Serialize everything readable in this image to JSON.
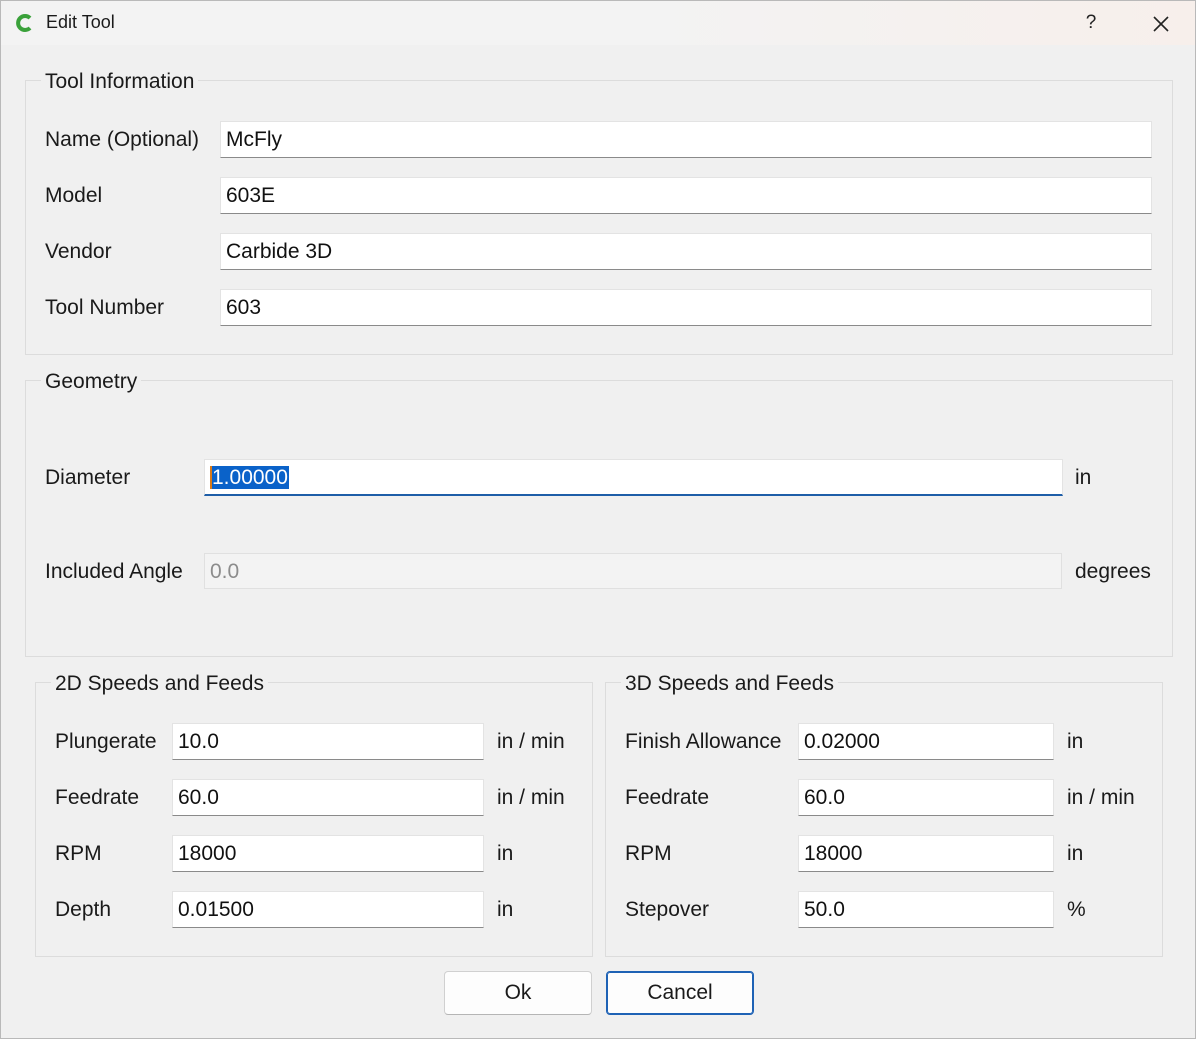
{
  "window": {
    "title": "Edit Tool",
    "help_label": "?",
    "close_icon": "close-icon",
    "app_icon": "carbide-create-icon",
    "accent_color": "#3aa13a"
  },
  "tool_information": {
    "title": "Tool Information",
    "name": {
      "label": "Name (Optional)",
      "value": "McFly"
    },
    "model": {
      "label": "Model",
      "value": "603E"
    },
    "vendor": {
      "label": "Vendor",
      "value": "Carbide 3D"
    },
    "tool_number": {
      "label": "Tool Number",
      "value": "603"
    }
  },
  "geometry": {
    "title": "Geometry",
    "diameter": {
      "label": "Diameter",
      "value": "1.00000",
      "unit": "in"
    },
    "included_angle": {
      "label": "Included Angle",
      "value": "0.0",
      "unit": "degrees"
    }
  },
  "speeds_2d": {
    "title": "2D Speeds and Feeds",
    "plungerate": {
      "label": "Plungerate",
      "value": "10.0",
      "unit": "in / min"
    },
    "feedrate": {
      "label": "Feedrate",
      "value": "60.0",
      "unit": "in / min"
    },
    "rpm": {
      "label": "RPM",
      "value": "18000",
      "unit": "in"
    },
    "depth": {
      "label": "Depth",
      "value": "0.01500",
      "unit": "in"
    }
  },
  "speeds_3d": {
    "title": "3D Speeds and Feeds",
    "finish_allowance": {
      "label": "Finish Allowance",
      "value": "0.02000",
      "unit": "in"
    },
    "feedrate": {
      "label": "Feedrate",
      "value": "60.0",
      "unit": "in / min"
    },
    "rpm": {
      "label": "RPM",
      "value": "18000",
      "unit": "in"
    },
    "stepover": {
      "label": "Stepover",
      "value": "50.0",
      "unit": "%"
    }
  },
  "buttons": {
    "ok": "Ok",
    "cancel": "Cancel"
  }
}
